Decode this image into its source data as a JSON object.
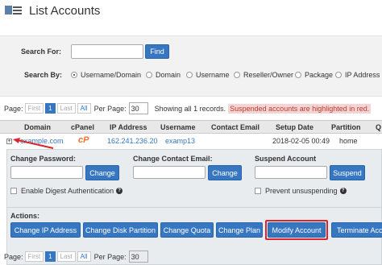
{
  "header": {
    "title": "List Accounts",
    "icon": "list-accounts-icon"
  },
  "search": {
    "label": "Search For:",
    "value": "",
    "find_label": "Find",
    "by_label": "Search By:",
    "options": [
      "Username/Domain",
      "Domain",
      "Username",
      "Reseller/Owner",
      "Package",
      "IP Address"
    ],
    "selected": "Username/Domain"
  },
  "pager_top": {
    "page_label": "Page:",
    "first": "First",
    "current": "1",
    "last": "Last",
    "all": "All",
    "per_page_label": "Per Page:",
    "per_page": "30",
    "showing": "Showing all 1 records.",
    "suspended_note": "Suspended accounts are highlighted in red."
  },
  "table": {
    "columns": [
      "Domain",
      "cPanel",
      "IP Address",
      "Username",
      "Contact Email",
      "Setup Date",
      "Partition",
      "Q"
    ],
    "row": {
      "expander": "+",
      "domain": "example.com",
      "cpanel": "cP",
      "ip": "162.241.236.20",
      "username": "examp13",
      "email": "",
      "setup_date": "2018-02-05 00:49",
      "partition": "home"
    }
  },
  "details": {
    "change_password_label": "Change Password:",
    "change_label": "Change",
    "digest_label": "Enable Digest Authentication",
    "contact_email_label": "Change Contact Email:",
    "suspend_label": "Suspend Account",
    "suspend_button": "Suspend",
    "prevent_label": "Prevent unsuspending",
    "actions_label": "Actions:",
    "actions": [
      "Change IP Address",
      "Change Disk Partition",
      "Change Quota",
      "Change Plan",
      "Modify Account",
      "Terminate Account"
    ],
    "highlighted_action": "Modify Account"
  },
  "pager_bottom": {
    "page_label": "Page:",
    "first": "First",
    "current": "1",
    "last": "Last",
    "all": "All",
    "per_page_label": "Per Page:",
    "per_page": "30"
  },
  "colors": {
    "accent": "#3777c1",
    "highlight": "#d9262c",
    "suspended_bg": "#f3d5d5",
    "cpanel": "#ff6c2c"
  }
}
